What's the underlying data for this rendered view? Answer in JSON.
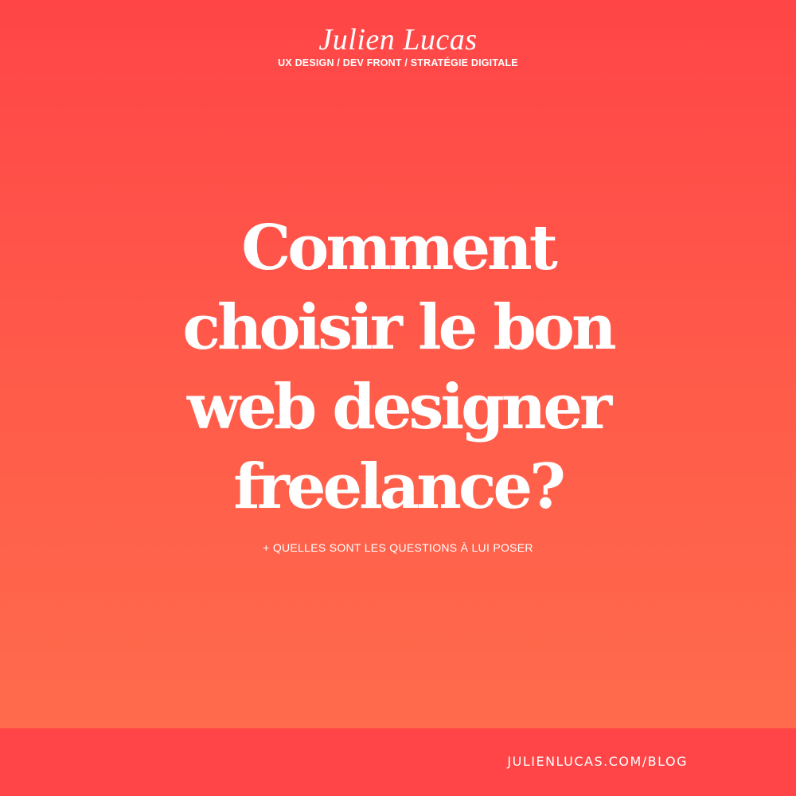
{
  "brand": {
    "name": "Julien Lucas",
    "tagline": "UX DESIGN / DEV FRONT / STRATÉGIE DIGITALE"
  },
  "headline": {
    "lines": [
      "Comment",
      "choisir le bon",
      "web designer",
      "freelance?"
    ]
  },
  "subtitle": "+ QUELLES SONT LES QUESTIONS À LUI POSER",
  "footer": {
    "url": "JULIENLUCAS.COM/BLOG"
  },
  "colors": {
    "background_top": "#ff4547",
    "background_bottom": "#ff6e4c",
    "footer_bar": "#ff4547",
    "text": "#ffffff"
  }
}
